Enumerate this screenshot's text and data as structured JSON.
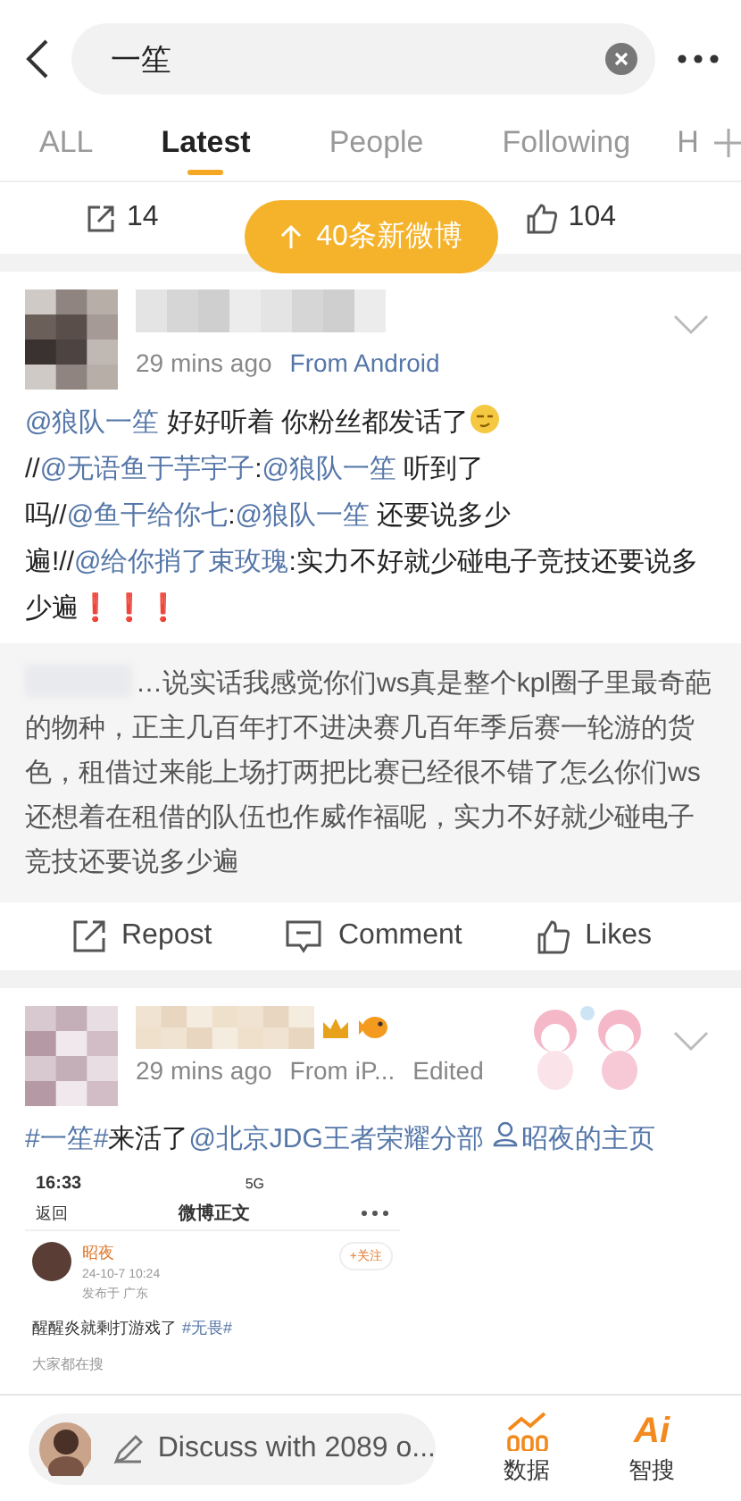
{
  "search": {
    "value": "一笙"
  },
  "tabs": [
    {
      "label": "ALL",
      "selected": false
    },
    {
      "label": "Latest",
      "selected": true
    },
    {
      "label": "People",
      "selected": false
    },
    {
      "label": "Following",
      "selected": false
    },
    {
      "label": "H",
      "selected": false
    }
  ],
  "stats": {
    "reposts": "14",
    "likes": "104"
  },
  "new_posts_pill": "40条新微博",
  "posts": [
    {
      "meta": {
        "time": "29 mins ago",
        "source": "From Android"
      },
      "content": [
        {
          "kind": "mention",
          "text": "@狼队一笙"
        },
        {
          "kind": "text",
          "text": " 好好听着 你粉丝都发话了"
        },
        {
          "kind": "emoji"
        },
        {
          "kind": "text",
          "text": "//"
        },
        {
          "kind": "mention",
          "text": "@无语鱼于芋宇子"
        },
        {
          "kind": "text",
          "text": ":"
        },
        {
          "kind": "mention",
          "text": "@狼队一笙"
        },
        {
          "kind": "text",
          "text": " 听到了吗//"
        },
        {
          "kind": "mention",
          "text": "@鱼干给你七"
        },
        {
          "kind": "text",
          "text": ":"
        },
        {
          "kind": "mention",
          "text": "@狼队一笙"
        },
        {
          "kind": "text",
          "text": " 还要说多少遍!//"
        },
        {
          "kind": "mention",
          "text": "@给你捎了束玫瑰"
        },
        {
          "kind": "text",
          "text": ":实力不好就少碰电子竞技还要说多少遍"
        },
        {
          "kind": "alert",
          "text": "❗❗❗"
        }
      ],
      "quote": "…说实话我感觉你们ws真是整个kpl圈子里最奇葩的物种，正主几百年打不进决赛几百年季后赛一轮游的货色，租借过来能上场打两把比赛已经很不错了怎么你们ws还想着在租借的队伍也作威作福呢，实力不好就少碰电子竞技还要说多少遍",
      "actions": [
        "Repost",
        "Comment",
        "Likes"
      ]
    },
    {
      "meta": {
        "time": "29 mins ago",
        "source": "From iP...",
        "edited": "Edited"
      },
      "content": [
        {
          "kind": "mention",
          "text": "#一笙#"
        },
        {
          "kind": "text",
          "text": "来活了"
        },
        {
          "kind": "mention",
          "text": "@北京JDG王者荣耀分部"
        },
        {
          "kind": "userlink",
          "text": "昭夜的主页"
        }
      ],
      "embedded": {
        "time": "16:33",
        "network": "5G",
        "back": "返回",
        "title": "微博正文",
        "user": "昭夜",
        "date": "24-10-7 10:24",
        "location": "发布于 广东",
        "follow": "+关注",
        "text": "醒醒炎就剩打游戏了",
        "tag": "#无畏#",
        "trending_label": "大家都在搜"
      }
    }
  ],
  "bottom_bar": {
    "discuss": "Discuss with 2089 o...",
    "buttons": [
      {
        "kind": "data",
        "label": "数据"
      },
      {
        "kind": "ai",
        "label": "智搜",
        "icon_text": "Ai"
      }
    ]
  }
}
